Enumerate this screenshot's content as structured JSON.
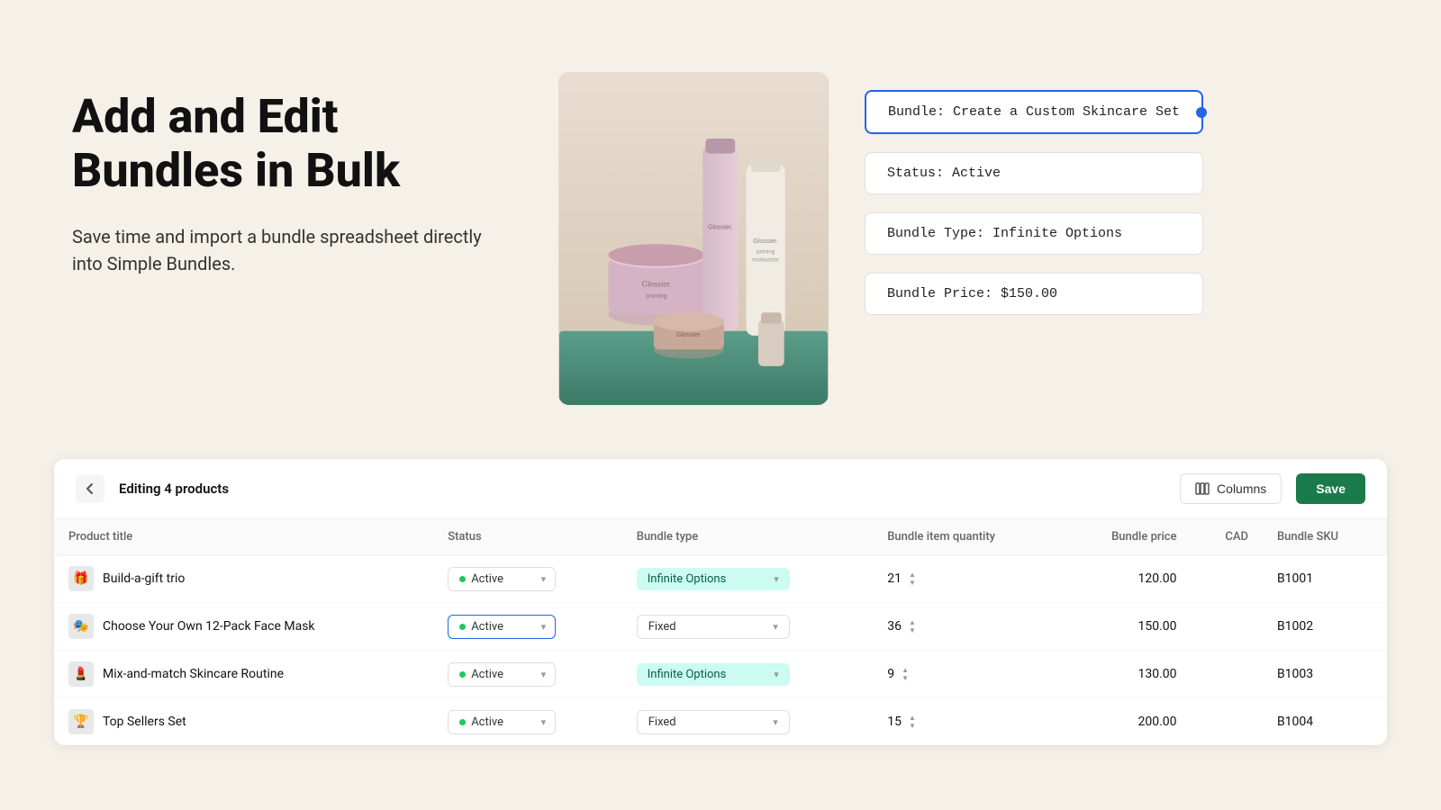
{
  "hero": {
    "title": "Add and Edit Bundles in Bulk",
    "subtitle": "Save time and import a bundle spreadsheet directly into Simple Bundles.",
    "tags": {
      "bundle_name": "Bundle: Create a Custom Skincare Set",
      "status": "Status: Active",
      "bundle_type": "Bundle Type: Infinite Options",
      "bundle_price": "Bundle Price: $150.00"
    }
  },
  "table": {
    "editing_label": "Editing 4 products",
    "columns_label": "Columns",
    "save_label": "Save",
    "columns": {
      "product_title": "Product title",
      "status": "Status",
      "bundle_type": "Bundle type",
      "bundle_item_quantity": "Bundle item quantity",
      "bundle_price": "Bundle price",
      "currency": "CAD",
      "bundle_sku": "Bundle SKU"
    },
    "rows": [
      {
        "icon": "🎁",
        "title": "Build-a-gift trio",
        "status": "Active",
        "status_focused": false,
        "bundle_type": "Infinite Options",
        "bundle_type_style": "infinite",
        "quantity": 21,
        "price": "120.00",
        "sku": "B1001"
      },
      {
        "icon": "🎭",
        "title": "Choose Your Own 12-Pack Face Mask",
        "status": "Active",
        "status_focused": true,
        "bundle_type": "Fixed",
        "bundle_type_style": "fixed",
        "quantity": 36,
        "price": "150.00",
        "sku": "B1002"
      },
      {
        "icon": "💄",
        "title": "Mix-and-match Skincare Routine",
        "status": "Active",
        "status_focused": false,
        "bundle_type": "Infinite Options",
        "bundle_type_style": "infinite",
        "quantity": 9,
        "price": "130.00",
        "sku": "B1003"
      },
      {
        "icon": "🏆",
        "title": "Top Sellers Set",
        "status": "Active",
        "status_focused": false,
        "bundle_type": "Fixed",
        "bundle_type_style": "fixed",
        "quantity": 15,
        "price": "200.00",
        "sku": "B1004"
      }
    ]
  }
}
